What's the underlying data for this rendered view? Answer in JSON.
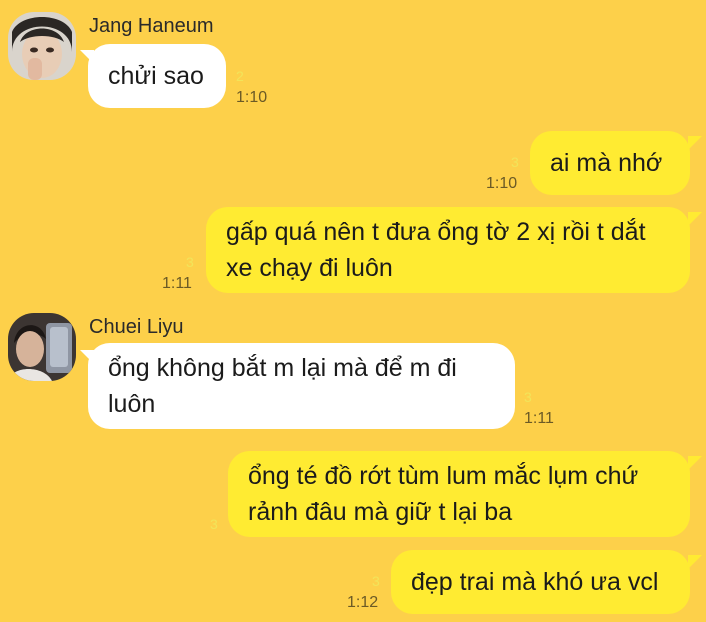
{
  "theme": {
    "background": "#FDD04A",
    "outgoing_bubble": "#FFEB32",
    "incoming_bubble": "#FFFFFF",
    "unread_color": "#F2E45A"
  },
  "messages": [
    {
      "sender": "Jang Haneum",
      "text": "chửi sao",
      "unread": "2",
      "time": "1:10",
      "direction": "incoming",
      "avatar": "contact-avatar-icon"
    },
    {
      "text": "ai mà nhớ",
      "unread": "3",
      "time": "1:10",
      "direction": "outgoing"
    },
    {
      "text": "gấp quá nên t đưa ổng tờ 2 xị rồi t dắt xe chạy đi luôn",
      "unread": "3",
      "time": "1:11",
      "direction": "outgoing"
    },
    {
      "sender": "Chuei Liyu",
      "text": "ổng không bắt m lại mà để m đi luôn",
      "unread": "3",
      "time": "1:11",
      "direction": "incoming",
      "avatar": "contact-avatar-icon"
    },
    {
      "text": "ổng té đồ rớt tùm lum mắc lụm chứ rảnh đâu mà giữ t lại ba",
      "unread": "3",
      "time": "",
      "direction": "outgoing"
    },
    {
      "text": "đẹp trai mà khó ưa vcl",
      "unread": "3",
      "time": "1:12",
      "direction": "outgoing"
    }
  ]
}
